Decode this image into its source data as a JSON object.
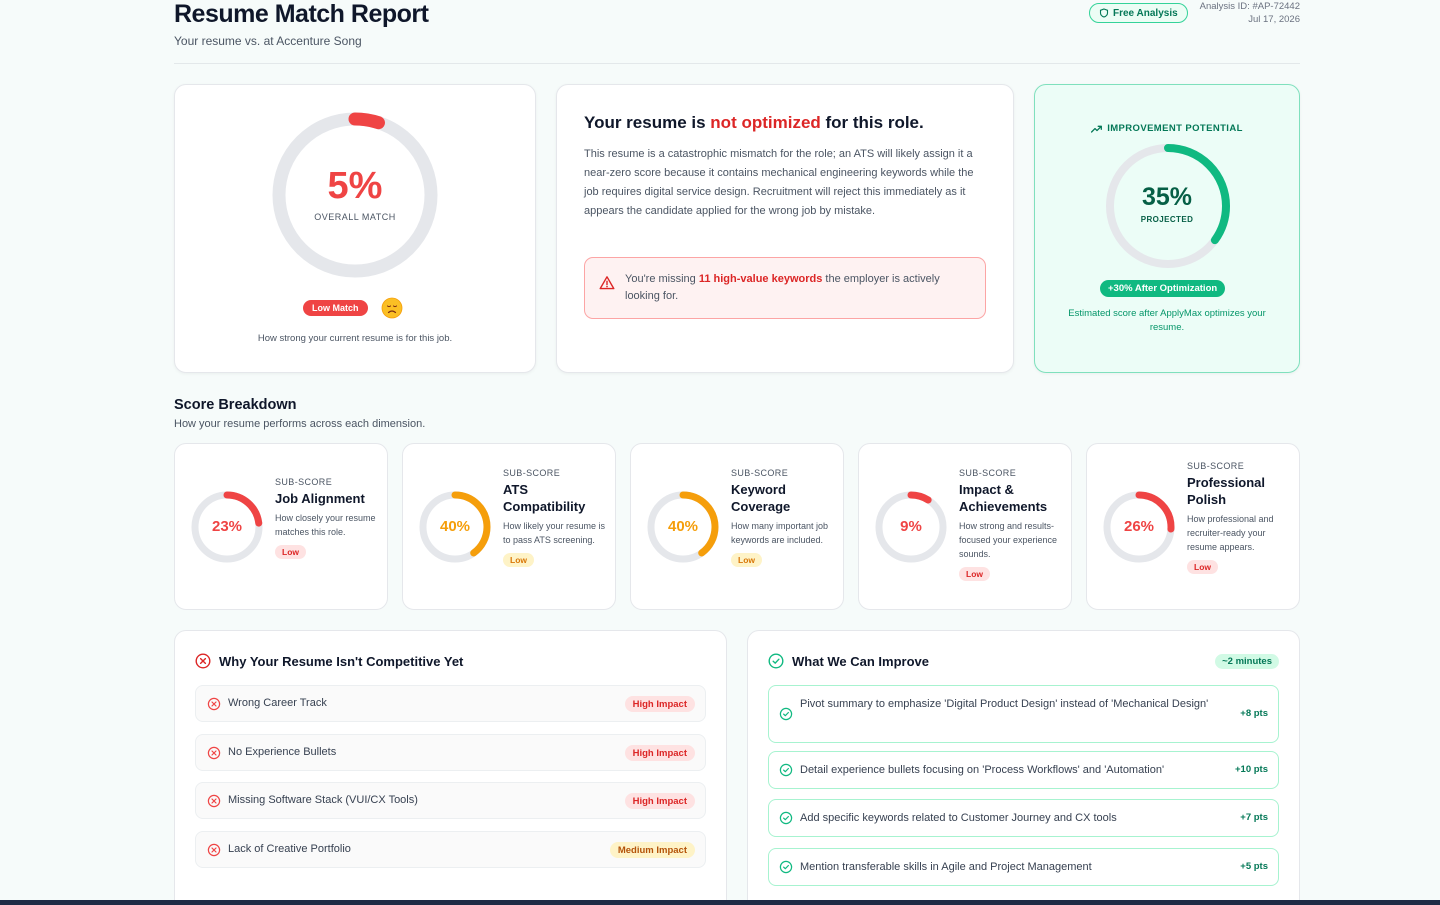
{
  "header": {
    "title": "Resume Match Report",
    "subtitle": "Your resume vs. at Accenture Song",
    "badge": "Free Analysis",
    "analysis_id": "Analysis ID: #AP-72442",
    "date": "Jul 17, 2026"
  },
  "overall": {
    "value": "5%",
    "fraction": 0.05,
    "label": "OVERALL MATCH",
    "badge": "Low Match",
    "emoji": "sad-face-icon",
    "caption": "How strong your current resume is for this job."
  },
  "assessment": {
    "headline_pre": "Your resume is ",
    "headline_highlight": "not optimized",
    "headline_post": " for this role.",
    "body": "This resume is a catastrophic mismatch for the role; an ATS will likely assign it a near-zero score because it contains mechanical engineering keywords while the job requires digital service design. Recruitment will reject this immediately as it appears the candidate applied for the wrong job by mistake.",
    "alert_pre": "You're missing ",
    "alert_highlight": "11 high-value keywords",
    "alert_post": " the employer is actively looking for."
  },
  "improvement": {
    "heading": "IMPROVEMENT POTENTIAL",
    "value": "35%",
    "fraction": 0.35,
    "label": "PROJECTED",
    "badge": "+30% After Optimization",
    "caption": "Estimated score after ApplyMax optimizes your resume."
  },
  "breakdown": {
    "title": "Score Breakdown",
    "subtitle": "How your resume performs across each dimension.",
    "kicker": "SUB-SCORE",
    "items": [
      {
        "value": "23%",
        "fraction": 0.23,
        "name": "Job Alignment",
        "desc": "How closely your resume matches this role.",
        "level": "Low",
        "color": "#ef4444"
      },
      {
        "value": "40%",
        "fraction": 0.4,
        "name": "ATS Compatibility",
        "desc": "How likely your resume is to pass ATS screening.",
        "level": "Low",
        "color": "#f59e0b"
      },
      {
        "value": "40%",
        "fraction": 0.4,
        "name": "Keyword Coverage",
        "desc": "How many important job keywords are included.",
        "level": "Low",
        "color": "#f59e0b"
      },
      {
        "value": "9%",
        "fraction": 0.09,
        "name": "Impact & Achievements",
        "desc": "How strong and results-focused your experience sounds.",
        "level": "Low",
        "color": "#ef4444"
      },
      {
        "value": "26%",
        "fraction": 0.26,
        "name": "Professional Polish",
        "desc": "How professional and recruiter-ready your resume appears.",
        "level": "Low",
        "color": "#ef4444"
      }
    ]
  },
  "issues": {
    "title": "Why Your Resume Isn't Competitive Yet",
    "items": [
      {
        "label": "Wrong Career Track",
        "impact": "High Impact"
      },
      {
        "label": "No Experience Bullets",
        "impact": "High Impact"
      },
      {
        "label": "Missing Software Stack (VUI/CX Tools)",
        "impact": "High Impact"
      },
      {
        "label": "Lack of Creative Portfolio",
        "impact": "Medium Impact"
      }
    ]
  },
  "improvements": {
    "title": "What We Can Improve",
    "badge": "~2 minutes",
    "items": [
      {
        "label": "Pivot summary to emphasize 'Digital Product Design' instead of 'Mechanical Design'",
        "pts": "+8 pts"
      },
      {
        "label": "Detail experience bullets focusing on 'Process Workflows' and 'Automation'",
        "pts": "+10 pts"
      },
      {
        "label": "Add specific keywords related to Customer Journey and CX tools",
        "pts": "+7 pts"
      },
      {
        "label": "Mention transferable skills in Agile and Project Management",
        "pts": "+5 pts"
      }
    ]
  },
  "colors": {
    "red": "#ef4444",
    "amber": "#f59e0b",
    "green": "#10b981",
    "track": "#e5e7eb"
  }
}
